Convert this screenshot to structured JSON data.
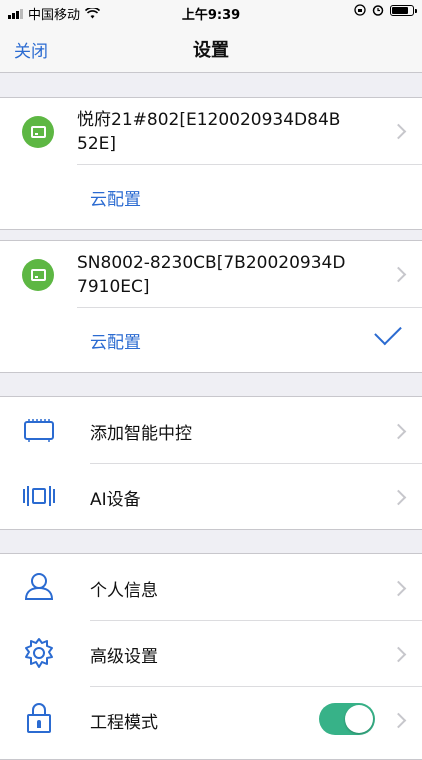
{
  "status_bar": {
    "carrier": "中国移动",
    "time": "上午9:39"
  },
  "nav": {
    "close_label": "关闭",
    "title": "设置"
  },
  "devices": [
    {
      "name": "悦府21#802[E120020934D84B52E]",
      "cloud_label": "云配置",
      "selected": false
    },
    {
      "name": "SN8002-8230CB[7B20020934D7910EC]",
      "cloud_label": "云配置",
      "selected": true
    }
  ],
  "menu": {
    "add_controller": "添加智能中控",
    "ai_devices": "AI设备",
    "personal_info": "个人信息",
    "advanced_settings": "高级设置",
    "engineering_mode": "工程模式"
  },
  "engineering_mode_enabled": true,
  "colors": {
    "accent": "#2b6bd1",
    "device_green": "#5db743",
    "toggle_on": "#37b288"
  },
  "icons": [
    "signal-icon",
    "wifi-icon",
    "rotation-lock-icon",
    "alarm-icon",
    "battery-icon",
    "device-icon",
    "controller-icon",
    "ai-device-icon",
    "user-icon",
    "gear-icon",
    "lock-icon",
    "chevron-right-icon",
    "checkmark-icon"
  ]
}
